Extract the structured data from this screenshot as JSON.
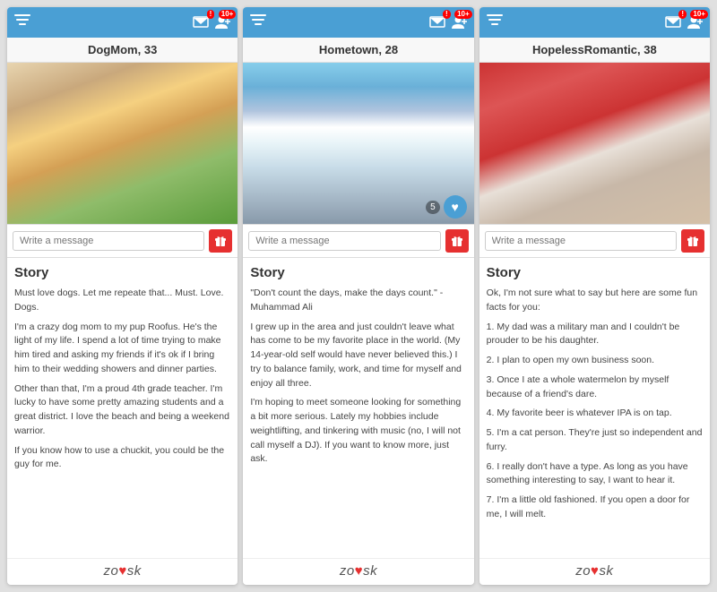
{
  "cards": [
    {
      "id": "card-1",
      "name": "DogMom, 33",
      "photo_alt": "DogMom profile photo",
      "photo_class": "photo-1",
      "message_placeholder": "Write a message",
      "story_title": "Story",
      "story_paragraphs": [
        "Must love dogs. Let me repeate that... Must. Love. Dogs.",
        "I'm a crazy dog mom to my pup Roofus. He's the light of my life. I spend a lot of time trying to make him tired and asking my friends if it's ok if I bring him to their wedding showers and dinner parties.",
        "Other than that, I'm a proud 4th grade teacher. I'm lucky to have some pretty amazing students and a great district. I love the beach and being a weekend warrior.",
        "If you know how to use a chuckit, you could be the guy for me."
      ],
      "photo_count": null,
      "has_heart": false
    },
    {
      "id": "card-2",
      "name": "Hometown, 28",
      "photo_alt": "Hometown profile photo",
      "photo_class": "photo-2",
      "message_placeholder": "Write a message",
      "story_title": "Story",
      "story_paragraphs": [
        "\"Don't count the days, make the days count.\" -Muhammad Ali",
        "I grew up in the area and just couldn't leave what has come to be my favorite place in the world. (My 14-year-old self would have never believed this.) I try to balance family, work, and time for myself and enjoy all three.",
        "I'm hoping to meet someone looking for something a bit more serious. Lately my hobbies include weightlifting, and tinkering with music (no, I will not call myself a DJ). If you want to know more, just ask."
      ],
      "photo_count": "5",
      "has_heart": true
    },
    {
      "id": "card-3",
      "name": "HopelessRomantic, 38",
      "photo_alt": "HopelessRomantic profile photo",
      "photo_class": "photo-3",
      "message_placeholder": "Write a message",
      "story_title": "Story",
      "story_paragraphs": [
        "Ok, I'm not sure what to say but here are some fun facts for you:",
        "1. My dad was a military man and I couldn't be prouder to be his daughter.",
        "2. I plan to open my own business soon.",
        "3. Once I ate a whole watermelon by myself because of a friend's dare.",
        "4. My favorite beer is whatever IPA is on tap.",
        "5. I'm a cat person. They're just so independent and furry.",
        "6. I really don't have a type. As long as you have something interesting to say, I want to hear it.",
        "7. I'm a little old fashioned. If you open a door for me, I will melt."
      ],
      "photo_count": null,
      "has_heart": false
    }
  ],
  "header": {
    "badge_exclaim": "!",
    "badge_10plus": "10+",
    "filter_label": "filter",
    "compose_label": "compose",
    "addperson_label": "add"
  },
  "zoosk": {
    "logo_text": "zo",
    "heart": "♥",
    "logo_text2": "sk"
  }
}
